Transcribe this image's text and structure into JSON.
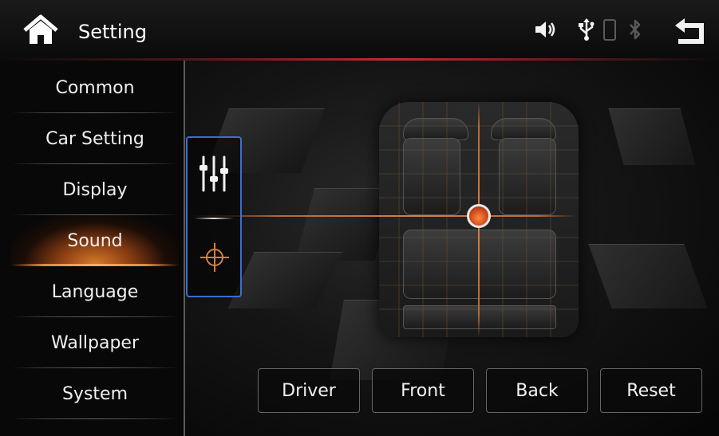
{
  "header": {
    "title": "Setting",
    "home_icon": "home-icon",
    "status_icons": [
      "volume-icon",
      "usb-icon",
      "phone-icon",
      "bluetooth-icon"
    ],
    "back_icon": "back-arrow-icon",
    "accent_color": "#c42c2c"
  },
  "sidebar": {
    "items": [
      {
        "label": "Common",
        "active": false
      },
      {
        "label": "Car Setting",
        "active": false
      },
      {
        "label": "Display",
        "active": false
      },
      {
        "label": "Sound",
        "active": true
      },
      {
        "label": "Language",
        "active": false
      },
      {
        "label": "Wallpaper",
        "active": false
      },
      {
        "label": "System",
        "active": false
      }
    ],
    "active_color": "#d67a2a"
  },
  "sound": {
    "modes": [
      "equalizer-icon",
      "crosshair-icon"
    ],
    "mode_box_color": "#3a6fd0",
    "balance_knob_color": "#e06020"
  },
  "buttons": {
    "driver": "Driver",
    "front": "Front",
    "back": "Back",
    "reset": "Reset"
  }
}
